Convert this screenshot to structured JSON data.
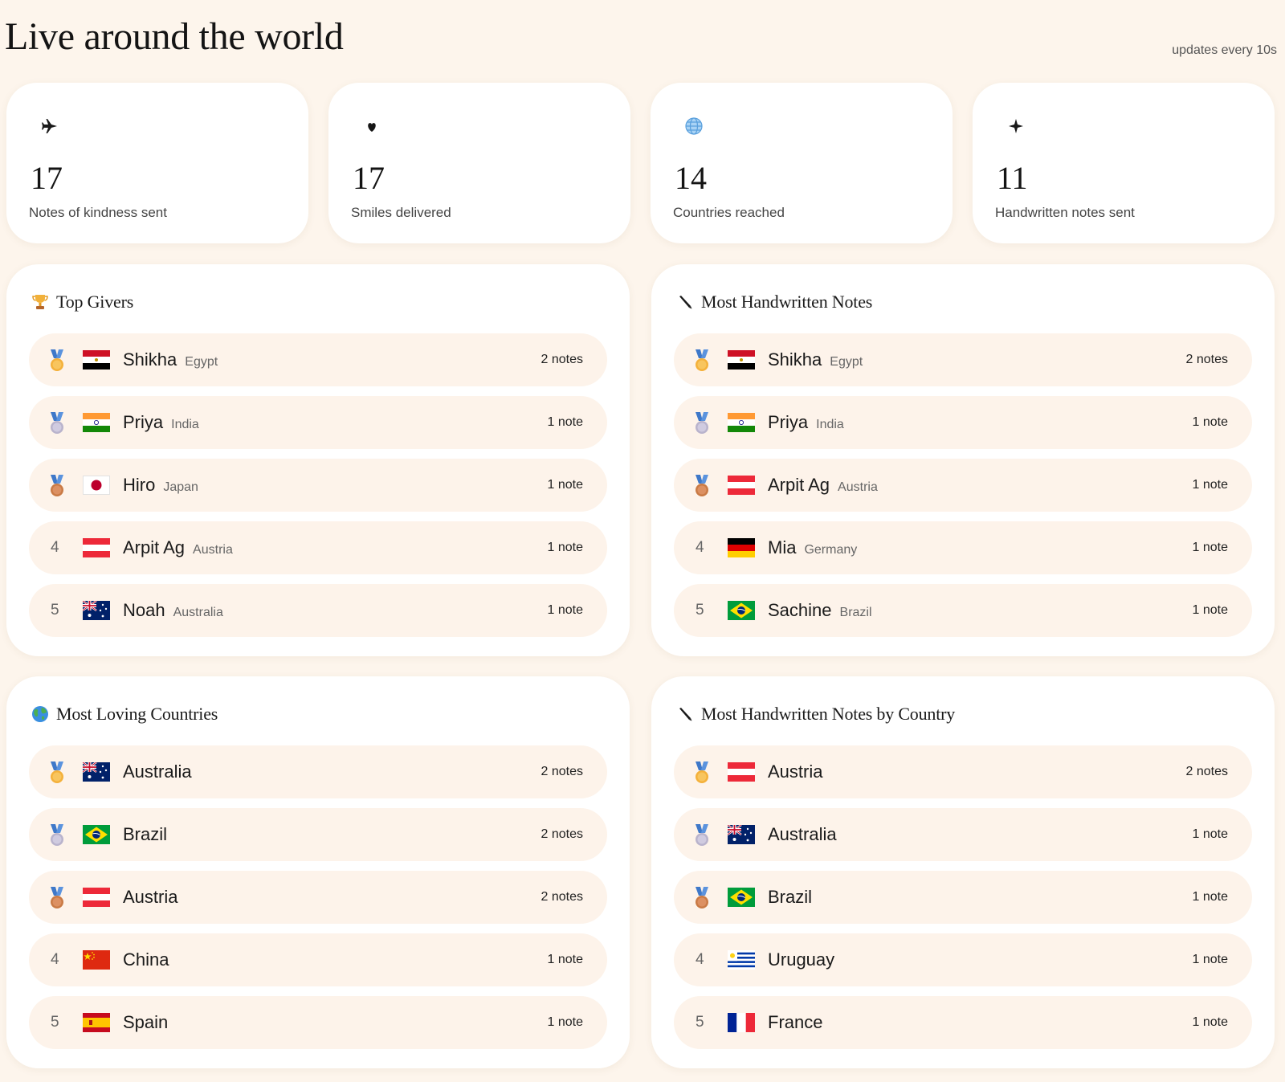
{
  "header": {
    "title": "Live around the world",
    "update_note": "updates every 10s"
  },
  "stats": [
    {
      "icon": "airplane-icon",
      "value": "17",
      "label": "Notes of kindness sent"
    },
    {
      "icon": "heart-icon",
      "value": "17",
      "label": "Smiles delivered"
    },
    {
      "icon": "globe-icon",
      "value": "14",
      "label": "Countries reached"
    },
    {
      "icon": "sparkle-icon",
      "value": "11",
      "label": "Handwritten notes sent"
    }
  ],
  "panels": [
    {
      "title": "Top Givers",
      "icon": "trophy-icon",
      "rows": [
        {
          "rank": "1",
          "medal": "gold-medal-icon",
          "flag": "egypt",
          "name": "Shikha",
          "sub": "Egypt",
          "count": "2 notes"
        },
        {
          "rank": "2",
          "medal": "silver-medal-icon",
          "flag": "india",
          "name": "Priya",
          "sub": "India",
          "count": "1 note"
        },
        {
          "rank": "3",
          "medal": "bronze-medal-icon",
          "flag": "japan",
          "name": "Hiro",
          "sub": "Japan",
          "count": "1 note"
        },
        {
          "rank": "4",
          "medal": "",
          "flag": "austria",
          "name": "Arpit Ag",
          "sub": "Austria",
          "count": "1 note"
        },
        {
          "rank": "5",
          "medal": "",
          "flag": "australia",
          "name": "Noah",
          "sub": "Australia",
          "count": "1 note"
        }
      ]
    },
    {
      "title": "Most Handwritten Notes",
      "icon": "pen-icon",
      "rows": [
        {
          "rank": "1",
          "medal": "gold-medal-icon",
          "flag": "egypt",
          "name": "Shikha",
          "sub": "Egypt",
          "count": "2 notes"
        },
        {
          "rank": "2",
          "medal": "silver-medal-icon",
          "flag": "india",
          "name": "Priya",
          "sub": "India",
          "count": "1 note"
        },
        {
          "rank": "3",
          "medal": "bronze-medal-icon",
          "flag": "austria",
          "name": "Arpit Ag",
          "sub": "Austria",
          "count": "1 note"
        },
        {
          "rank": "4",
          "medal": "",
          "flag": "germany",
          "name": "Mia",
          "sub": "Germany",
          "count": "1 note"
        },
        {
          "rank": "5",
          "medal": "",
          "flag": "brazil",
          "name": "Sachine",
          "sub": "Brazil",
          "count": "1 note"
        }
      ]
    },
    {
      "title": "Most Loving Countries",
      "icon": "globe-icon",
      "rows": [
        {
          "rank": "1",
          "medal": "gold-medal-icon",
          "flag": "australia",
          "name": "Australia",
          "sub": "",
          "count": "2 notes"
        },
        {
          "rank": "2",
          "medal": "silver-medal-icon",
          "flag": "brazil",
          "name": "Brazil",
          "sub": "",
          "count": "2 notes"
        },
        {
          "rank": "3",
          "medal": "bronze-medal-icon",
          "flag": "austria",
          "name": "Austria",
          "sub": "",
          "count": "2 notes"
        },
        {
          "rank": "4",
          "medal": "",
          "flag": "china",
          "name": "China",
          "sub": "",
          "count": "1 note"
        },
        {
          "rank": "5",
          "medal": "",
          "flag": "spain",
          "name": "Spain",
          "sub": "",
          "count": "1 note"
        }
      ]
    },
    {
      "title": "Most Handwritten Notes by Country",
      "icon": "pen-icon",
      "rows": [
        {
          "rank": "1",
          "medal": "gold-medal-icon",
          "flag": "austria",
          "name": "Austria",
          "sub": "",
          "count": "2 notes"
        },
        {
          "rank": "2",
          "medal": "silver-medal-icon",
          "flag": "australia",
          "name": "Australia",
          "sub": "",
          "count": "1 note"
        },
        {
          "rank": "3",
          "medal": "bronze-medal-icon",
          "flag": "brazil",
          "name": "Brazil",
          "sub": "",
          "count": "1 note"
        },
        {
          "rank": "4",
          "medal": "",
          "flag": "uruguay",
          "name": "Uruguay",
          "sub": "",
          "count": "1 note"
        },
        {
          "rank": "5",
          "medal": "",
          "flag": "france",
          "name": "France",
          "sub": "",
          "count": "1 note"
        }
      ]
    }
  ]
}
